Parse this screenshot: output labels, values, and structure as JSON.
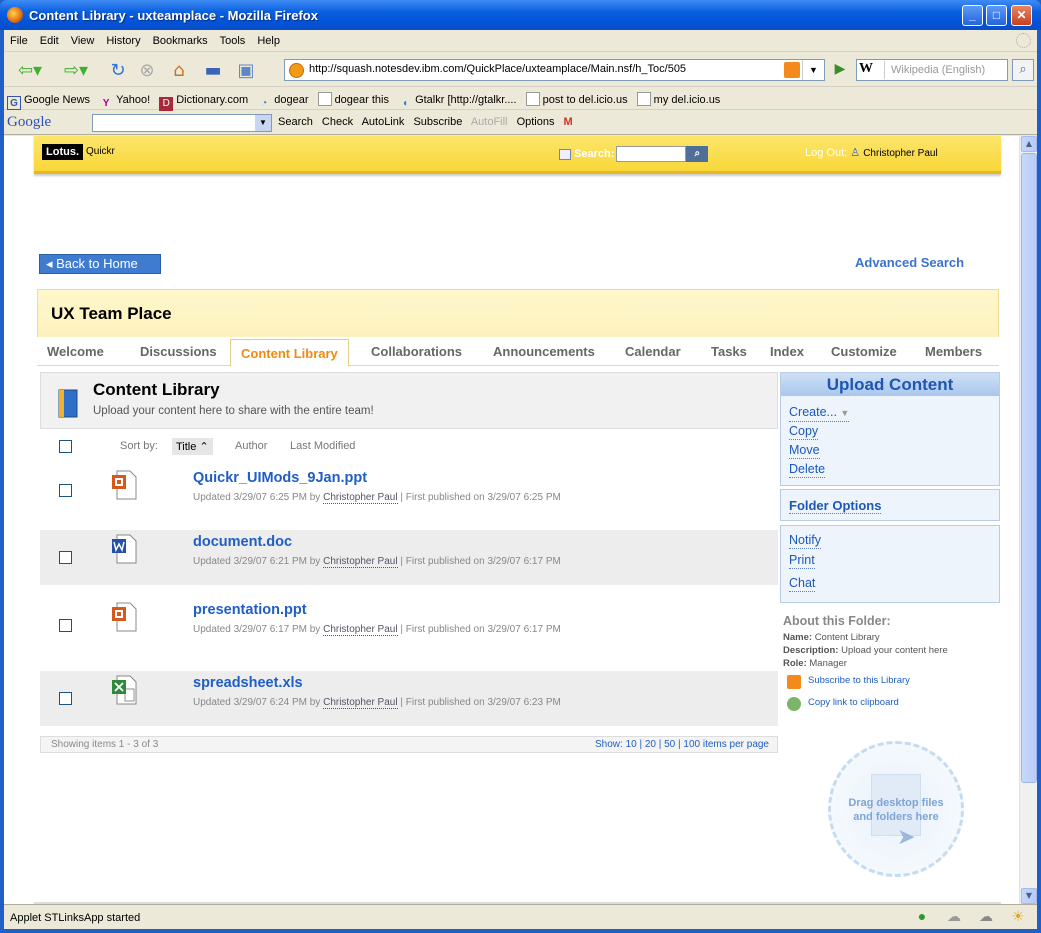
{
  "window": {
    "title": "Content Library - uxteamplace - Mozilla Firefox",
    "min": "_",
    "max": "□",
    "close": "✕"
  },
  "menu": [
    "File",
    "Edit",
    "View",
    "History",
    "Bookmarks",
    "Tools",
    "Help"
  ],
  "nav": {
    "url": "http://squash.notesdev.ibm.com/QuickPlace/uxteamplace/Main.nsf/h_Toc/505",
    "search_engine": "W",
    "search_placeholder": "Wikipedia (English)"
  },
  "bookmarks": [
    "Google News",
    "Yahoo!",
    "Dictionary.com",
    "dogear",
    "dogear this",
    "Gtalkr [http://gtalkr....",
    "post to del.icio.us",
    "my del.icio.us"
  ],
  "googlebar": {
    "logo": "Google",
    "items": [
      "Search",
      "Check",
      "AutoLink",
      "Subscribe",
      "AutoFill",
      "Options"
    ]
  },
  "quickr": {
    "brand": "Lotus.",
    "product": "Quickr",
    "search_label": "Search:",
    "logout_label": "Log Out:",
    "user": "Christopher Paul",
    "back_home": "Back to Home",
    "advanced_search": "Advanced Search",
    "place_title": "UX Team Place",
    "tabs": [
      "Welcome",
      "Discussions",
      "Content Library",
      "Collaborations",
      "Announcements",
      "Calendar",
      "Tasks",
      "Index",
      "Customize",
      "Members"
    ]
  },
  "library": {
    "title": "Content Library",
    "subtitle": "Upload your content here to share with the entire team!",
    "sort_label": "Sort by:",
    "sort_title": "Title",
    "sort_author": "Author",
    "sort_modified": "Last Modified",
    "files": [
      {
        "name": "Quickr_UIMods_9Jan.ppt",
        "updated": "Updated 3/29/07 6:25 PM by",
        "author": "Christopher Paul",
        "published": "| First published on 3/29/07 6:25 PM",
        "type": "ppt"
      },
      {
        "name": "document.doc",
        "updated": "Updated 3/29/07 6:21 PM by",
        "author": "Christopher Paul",
        "published": "| First published on 3/29/07 6:17 PM",
        "type": "doc"
      },
      {
        "name": "presentation.ppt",
        "updated": "Updated 3/29/07 6:17 PM by",
        "author": "Christopher Paul",
        "published": "| First published on 3/29/07 6:17 PM",
        "type": "ppt"
      },
      {
        "name": "spreadsheet.xls",
        "updated": "Updated 3/29/07 6:24 PM by",
        "author": "Christopher Paul",
        "published": "| First published on 3/29/07 6:23 PM",
        "type": "xls"
      }
    ],
    "showing": "Showing items 1 - 3 of 3",
    "show_label": "Show: 10  | 20  | 50  | 100 items per page"
  },
  "side": {
    "upload": "Upload Content",
    "create": "Create...",
    "copy": "Copy",
    "move": "Move",
    "delete": "Delete",
    "folder_options": "Folder Options",
    "notify": "Notify",
    "print": "Print",
    "chat": "Chat",
    "about_title": "About this Folder:",
    "name_label": "Name:",
    "name_value": "Content Library",
    "desc_label": "Description:",
    "desc_value": "Upload your content here",
    "role_label": "Role:",
    "role_value": "Manager",
    "subscribe": "Subscribe to this Library",
    "copylink": "Copy link to clipboard",
    "drop_line1": "Drag desktop files",
    "drop_line2": "and folders here"
  },
  "status": {
    "text": "Applet STLinksApp started"
  }
}
